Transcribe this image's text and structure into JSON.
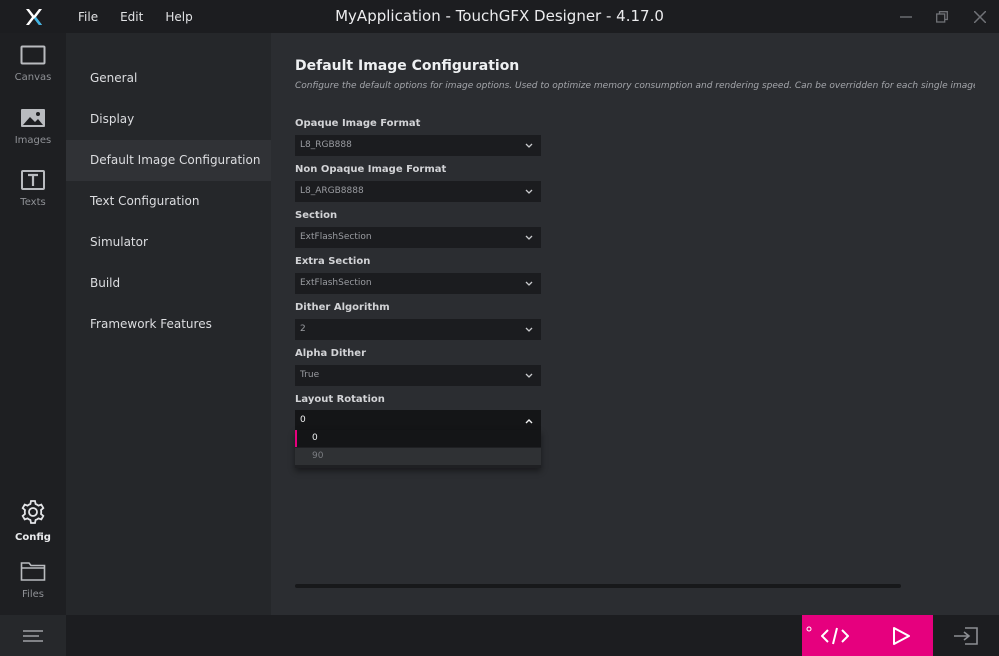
{
  "app": {
    "title": "MyApplication - TouchGFX Designer - 4.17.0",
    "logo_icon": "touchgfx-x-logo",
    "accent_color": "#e6007e"
  },
  "menu": {
    "items": [
      "File",
      "Edit",
      "Help"
    ]
  },
  "window_controls": [
    "minimize-icon",
    "restore-icon",
    "close-icon"
  ],
  "rail": {
    "top_items": [
      {
        "label": "Canvas",
        "icon": "canvas-icon"
      },
      {
        "label": "Images",
        "icon": "image-icon"
      },
      {
        "label": "Texts",
        "icon": "text-icon"
      }
    ],
    "bottom_items": [
      {
        "label": "Config",
        "icon": "gear-icon",
        "active": true
      },
      {
        "label": "Files",
        "icon": "folder-icon"
      }
    ]
  },
  "nav": {
    "items": [
      {
        "label": "General"
      },
      {
        "label": "Display"
      },
      {
        "label": "Default Image Configuration",
        "active": true
      },
      {
        "label": "Text Configuration"
      },
      {
        "label": "Simulator"
      },
      {
        "label": "Build"
      },
      {
        "label": "Framework Features"
      }
    ]
  },
  "main": {
    "title": "Default Image Configuration",
    "description": "Configure the default options for image options. Used to optimize memory consumption and rendering speed. Can be overridden for each single image i",
    "fields": [
      {
        "label": "Opaque Image Format",
        "value": "L8_RGB888"
      },
      {
        "label": "Non Opaque Image Format",
        "value": "L8_ARGB8888"
      },
      {
        "label": "Section",
        "value": "ExtFlashSection"
      },
      {
        "label": "Extra Section",
        "value": "ExtFlashSection"
      },
      {
        "label": "Dither Algorithm",
        "value": "2"
      },
      {
        "label": "Alpha Dither",
        "value": "True"
      },
      {
        "label": "Layout Rotation",
        "value": "0",
        "open": true,
        "options": [
          "0",
          "90"
        ]
      }
    ]
  },
  "bottombar": {
    "menu_icon": "hamburger-icon",
    "code_icon": "code-icon",
    "run_icon": "play-icon",
    "exit_icon": "sign-in-icon"
  }
}
